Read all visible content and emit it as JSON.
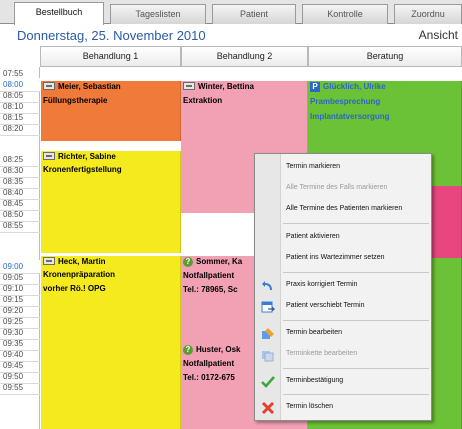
{
  "tabs": [
    {
      "label": "Bestellbuch",
      "active": true
    },
    {
      "label": "Tageslisten",
      "active": false
    },
    {
      "label": "Patient",
      "active": false
    },
    {
      "label": "Kontrolle",
      "active": false
    },
    {
      "label": "Zuordnu",
      "active": false
    }
  ],
  "header": {
    "date": "Donnerstag, 25. November 2010",
    "view_label": "Ansicht"
  },
  "columns": [
    "Behandlung 1",
    "Behandlung 2",
    "Beratung"
  ],
  "times": [
    "07:55",
    "08:00",
    "08:05",
    "08:10",
    "08:15",
    "08:20",
    "08:25",
    "08:30",
    "08:35",
    "08:40",
    "08:45",
    "08:50",
    "08:55",
    "09:00",
    "09:05",
    "09:10",
    "09:15",
    "09:20",
    "09:25",
    "09:30",
    "09:35",
    "09:40",
    "09:45",
    "09:50",
    "09:55"
  ],
  "appointments": {
    "meier": {
      "name": "Meier, Sebastian",
      "lines": [
        "Füllungstherapie"
      ]
    },
    "richter": {
      "name": "Richter, Sabine",
      "lines": [
        "Kronenfertigstellung"
      ]
    },
    "heck": {
      "name": "Heck, Martin",
      "lines": [
        "Kronenpräparation",
        "vorher Rö.! OPG"
      ]
    },
    "winter": {
      "name": "Winter, Bettina",
      "lines": [
        "Extraktion"
      ]
    },
    "sommer": {
      "name": "Sommer, Ka",
      "lines": [
        "Notfallpatient",
        "Tel.: 78965, Sc"
      ]
    },
    "huster": {
      "name": "Huster, Osk",
      "lines": [
        "Notfallpatient",
        "Tel.: 0172-675"
      ]
    },
    "glucklich": {
      "name": "Glücklich, Ulrike",
      "lines": [
        "Prambesprechung",
        "Implantatversorgung"
      ]
    }
  },
  "colors": {
    "orange": "#f07a3a",
    "yellow": "#f5ea1e",
    "pink": "#f2a0b4",
    "green": "#6cc236",
    "magenta": "#e8467e",
    "date_blue": "#2a5aa8"
  },
  "context_menu": [
    {
      "label": "Termin markieren",
      "disabled": false,
      "icon": ""
    },
    {
      "label": "Alle Termine des Falls markieren",
      "disabled": true,
      "icon": ""
    },
    {
      "label": "Alle Termine des Patienten markieren",
      "disabled": false,
      "icon": ""
    },
    {
      "label": "Patient aktivieren",
      "disabled": false,
      "icon": ""
    },
    {
      "label": "Patient ins Wartezimmer setzen",
      "disabled": false,
      "icon": ""
    },
    {
      "label": "Praxis korrigiert Termin",
      "disabled": false,
      "icon": "undo-arrow-icon"
    },
    {
      "label": "Patient verschiebt Termin",
      "disabled": false,
      "icon": "calendar-move-icon"
    },
    {
      "label": "Termin bearbeiten",
      "disabled": false,
      "icon": "edit-appointment-icon"
    },
    {
      "label": "Terminkette bearbeiten",
      "disabled": true,
      "icon": "edit-chain-icon"
    },
    {
      "label": "Terminbestätigung",
      "disabled": false,
      "icon": "checkmark-icon"
    },
    {
      "label": "Termin löschen",
      "disabled": false,
      "icon": "delete-x-icon"
    }
  ]
}
